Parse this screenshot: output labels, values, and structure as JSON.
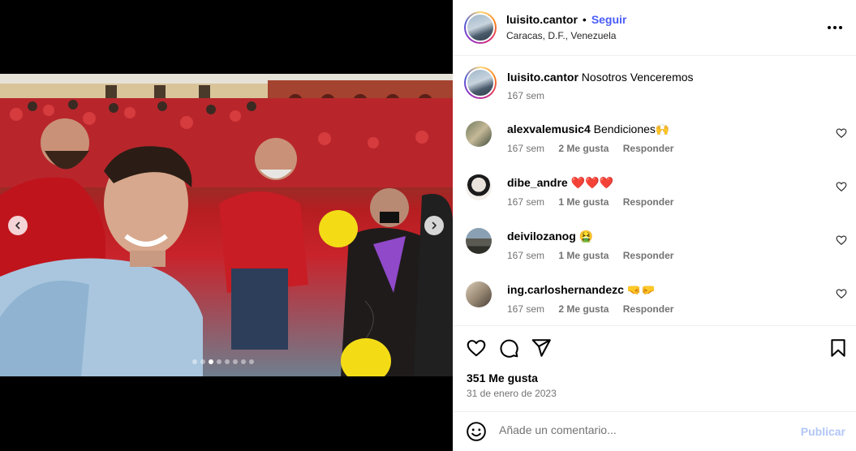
{
  "post": {
    "username": "luisito.cantor",
    "follow_label": "Seguir",
    "separator": "•",
    "location": "Caracas, D.F., Venezuela"
  },
  "caption": {
    "username": "luisito.cantor",
    "text": "Nosotros Venceremos",
    "time": "167 sem"
  },
  "comments": [
    {
      "username": "alexvalemusic4",
      "text": "Bendiciones🙌",
      "time": "167 sem",
      "likes": "2 Me gusta",
      "reply": "Responder"
    },
    {
      "username": "dibe_andre",
      "text": "❤️❤️❤️",
      "time": "167 sem",
      "likes": "1 Me gusta",
      "reply": "Responder"
    },
    {
      "username": "deivilozanog",
      "text": "🤮",
      "time": "167 sem",
      "likes": "1 Me gusta",
      "reply": "Responder"
    },
    {
      "username": "ing.carloshernandezc",
      "text": "🤜🤛",
      "time": "167 sem",
      "likes": "2 Me gusta",
      "reply": "Responder"
    }
  ],
  "footer": {
    "likes": "351 Me gusta",
    "date": "31 de enero de 2023"
  },
  "add_comment": {
    "placeholder": "Añade un comentario...",
    "publish_label": "Publicar"
  },
  "carousel": {
    "slide_count": 8,
    "active_index": 2
  },
  "colors": {
    "follow": "#4a5df9",
    "publish_disabled": "#b2c6f7",
    "meta_gray": "#737373"
  }
}
